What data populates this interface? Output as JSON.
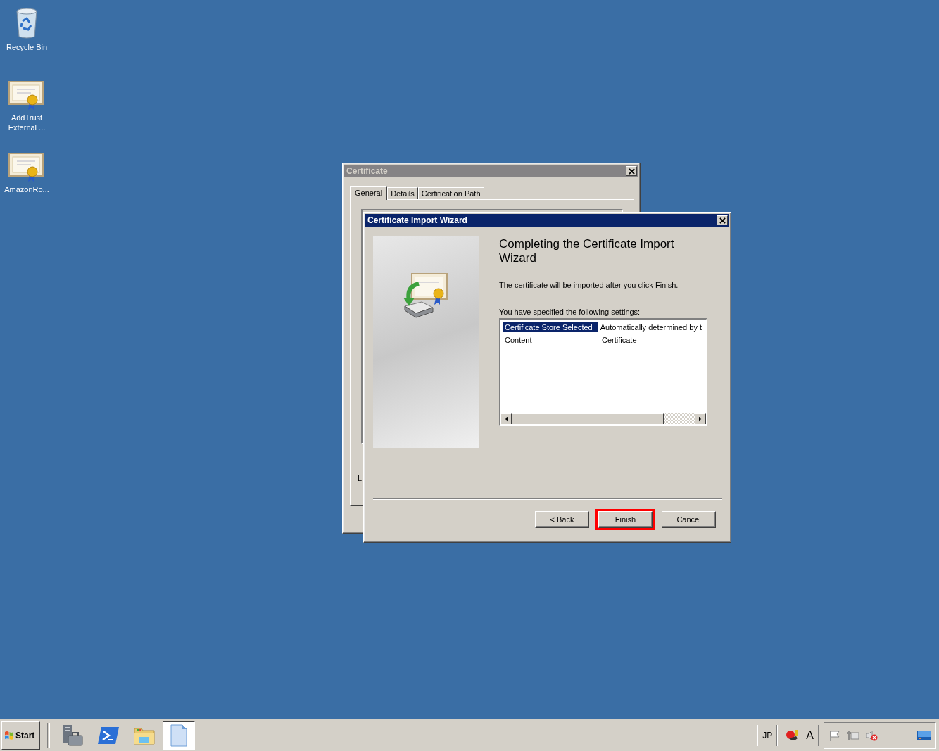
{
  "desktop_icons": [
    {
      "kind": "recycle-bin",
      "label": "Recycle Bin"
    },
    {
      "kind": "certificate",
      "label": "AddTrust External ..."
    },
    {
      "kind": "certificate",
      "label": "AmazonRo..."
    }
  ],
  "certificate_window": {
    "title": "Certificate",
    "tabs": [
      {
        "label": "General",
        "selected": true
      },
      {
        "label": "Details",
        "selected": false
      },
      {
        "label": "Certification Path",
        "selected": false
      }
    ],
    "cut_label": "L"
  },
  "wizard": {
    "title": "Certificate Import Wizard",
    "heading": "Completing the Certificate Import Wizard",
    "message": "The certificate will be imported after you click Finish.",
    "settings_label": "You have specified the following settings:",
    "settings": [
      {
        "setting": "Certificate Store Selected",
        "value": "Automatically determined by t",
        "selected": true
      },
      {
        "setting": "Content",
        "value": "Certificate",
        "selected": false
      }
    ],
    "buttons": [
      {
        "label": "< Back",
        "highlighted": false
      },
      {
        "label": "Finish",
        "highlighted": true
      },
      {
        "label": "Cancel",
        "highlighted": false
      }
    ]
  },
  "taskbar": {
    "start_label": "Start",
    "language": "JP",
    "ime": "A"
  }
}
